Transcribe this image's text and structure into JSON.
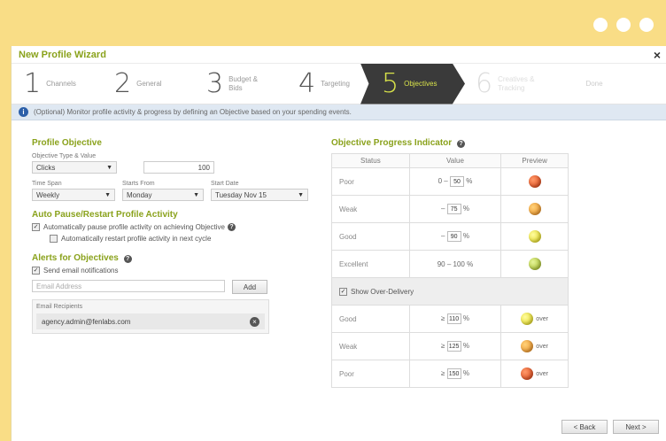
{
  "window": {
    "title": "New Profile Wizard",
    "close": "×"
  },
  "steps": [
    {
      "num": "1",
      "label": "Channels"
    },
    {
      "num": "2",
      "label": "General"
    },
    {
      "num": "3",
      "label": "Budget & Bids"
    },
    {
      "num": "4",
      "label": "Targeting"
    },
    {
      "num": "5",
      "label": "Objectives"
    },
    {
      "num": "6",
      "label": "Creatives & Tracking"
    }
  ],
  "done_label": "Done",
  "info": {
    "icon": "i",
    "text": "(Optional) Monitor profile activity & progress by defining an Objective based on your spending events."
  },
  "profile_objectives": {
    "heading": "Profile Objective",
    "type_label": "Objective Type & Value",
    "type_value": "Clicks",
    "value": "100",
    "time_span_label": "Time Span",
    "time_span_value": "Weekly",
    "starts_from_label": "Starts From",
    "starts_from_value": "Monday",
    "start_date_label": "Start Date",
    "start_date_value": "Tuesday Nov 15"
  },
  "auto_pause": {
    "heading": "Auto Pause/Restart Profile Activity",
    "check1": "Automatically pause profile activity on achieving Objective",
    "check2": "Automatically restart profile activity in next cycle"
  },
  "alerts": {
    "heading": "Alerts for Objectives",
    "check": "Send email notifications",
    "email_placeholder": "Email Address",
    "add_label": "Add",
    "recipients_label": "Email Recipients",
    "recipient": "agency.admin@fenlabs.com"
  },
  "indicator": {
    "heading": "Objective Progress Indicator",
    "columns": [
      "Status",
      "Value",
      "Preview"
    ],
    "rows": [
      {
        "status": "Poor",
        "pre": "0 –",
        "val": "50",
        "post": "%"
      },
      {
        "status": "Weak",
        "pre": "–",
        "val": "75",
        "post": "%"
      },
      {
        "status": "Good",
        "pre": "–",
        "val": "90",
        "post": "%"
      },
      {
        "status": "Excellent",
        "pre": "90 – 100 %",
        "val": "",
        "post": ""
      }
    ],
    "delivery_label": "Show Over-Delivery",
    "over_rows": [
      {
        "status": "Good",
        "pre": "≥",
        "val": "110",
        "post": "%",
        "ind": "over"
      },
      {
        "status": "Weak",
        "pre": "≥",
        "val": "125",
        "post": "%",
        "ind": "over"
      },
      {
        "status": "Poor",
        "pre": "≥",
        "val": "150",
        "post": "%",
        "ind": "over"
      }
    ]
  },
  "footer": {
    "back": "< Back",
    "next": "Next >"
  },
  "colors": {
    "accent": "#8aa21c",
    "active_step": "#3a3a3a",
    "frame": "#f9dd86"
  }
}
